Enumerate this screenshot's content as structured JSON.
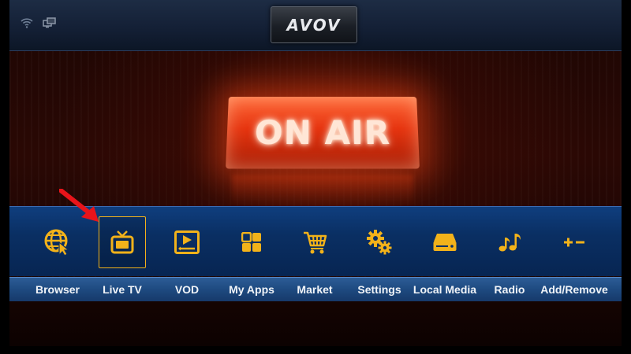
{
  "header": {
    "logo_text": "AVOV",
    "status_icons": [
      "wifi-icon",
      "network-icon"
    ]
  },
  "background": {
    "sign_text": "ON AIR",
    "sign_color": "#e63510"
  },
  "menu": {
    "selected_index": 1,
    "accent_color": "#f2b21a",
    "items": [
      {
        "label": "Browser",
        "icon": "globe-cursor-icon"
      },
      {
        "label": "Live TV",
        "icon": "tv-icon"
      },
      {
        "label": "VOD",
        "icon": "video-player-icon"
      },
      {
        "label": "My Apps",
        "icon": "apps-grid-icon"
      },
      {
        "label": "Market",
        "icon": "shopping-cart-icon"
      },
      {
        "label": "Settings",
        "icon": "gears-icon"
      },
      {
        "label": "Local Media",
        "icon": "hard-drive-icon"
      },
      {
        "label": "Radio",
        "icon": "music-notes-icon"
      },
      {
        "label": "Add/Remove",
        "icon": "plus-minus-icon"
      }
    ]
  }
}
